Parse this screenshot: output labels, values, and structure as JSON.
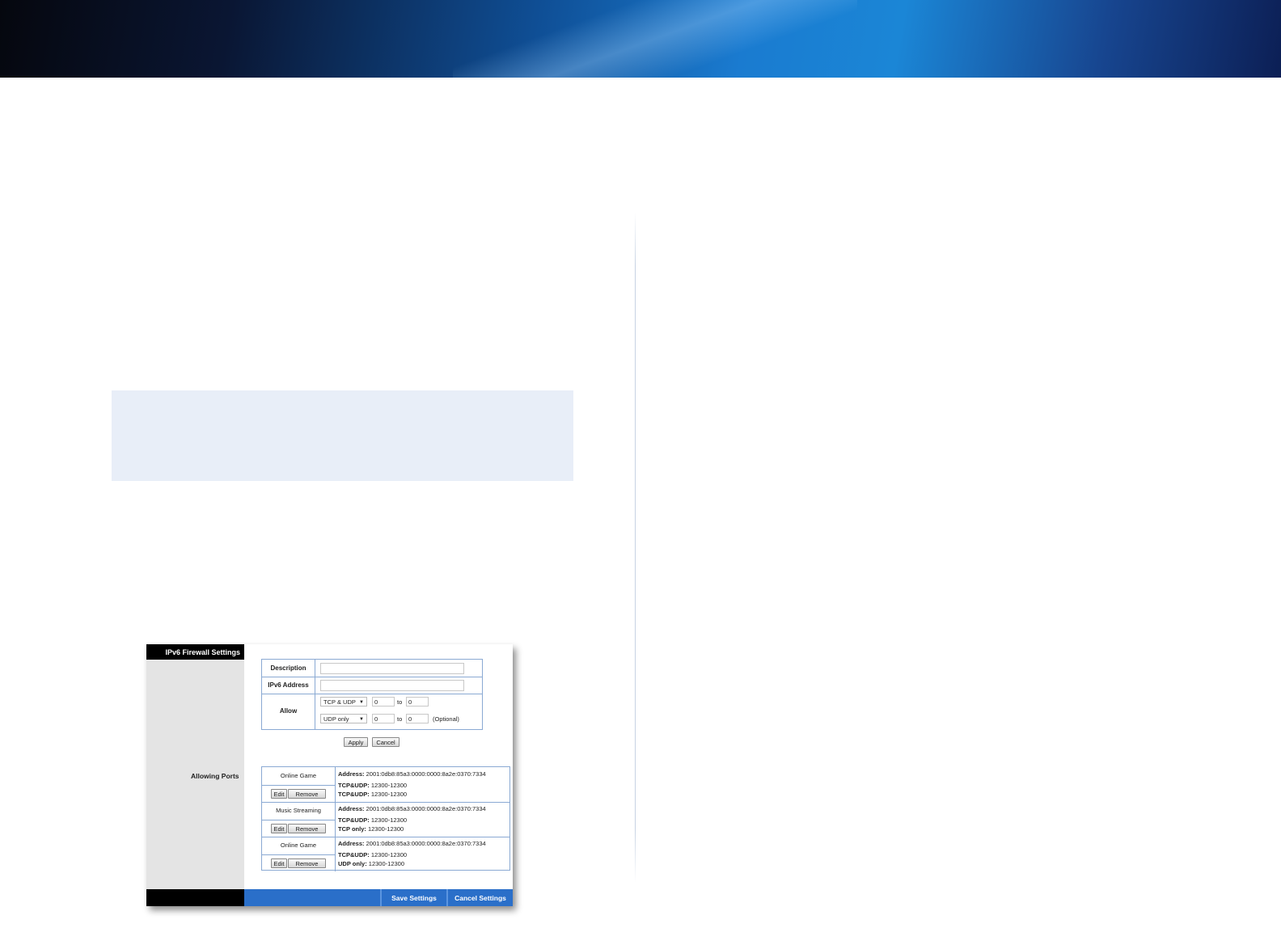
{
  "colors": {
    "banner_blue": "#1b86d6",
    "note_bg": "#e8eef8",
    "footer_blue": "#2a6fc9"
  },
  "screenshot": {
    "side_title": "IPv6 Firewall Settings",
    "side_label": "Allowing Ports",
    "form": {
      "description_label": "Description",
      "ipv6_label": "IPv6 Address",
      "allow_label": "Allow",
      "row1": {
        "protocol": "TCP & UDP",
        "from": "0",
        "to_word": "to",
        "to": "0"
      },
      "row2": {
        "protocol": "UDP only",
        "from": "0",
        "to_word": "to",
        "to": "0",
        "optional": "(Optional)"
      },
      "apply_label": "Apply",
      "cancel_label": "Cancel"
    },
    "ports": [
      {
        "name": "Online Game",
        "address_label": "Address:",
        "address": "2001:0db8:85a3:0000:0000:8a2e:0370:7334",
        "line1_label": "TCP&UDP:",
        "line1_value": "12300-12300",
        "line2_label": "TCP&UDP:",
        "line2_value": "12300-12300"
      },
      {
        "name": "Music Streaming",
        "address_label": "Address:",
        "address": "2001:0db8:85a3:0000:0000:8a2e:0370:7334",
        "line1_label": "TCP&UDP:",
        "line1_value": "12300-12300",
        "line2_label": "TCP only:",
        "line2_value": "12300-12300"
      },
      {
        "name": "Online Game",
        "address_label": "Address:",
        "address": "2001:0db8:85a3:0000:0000:8a2e:0370:7334",
        "line1_label": "TCP&UDP:",
        "line1_value": "12300-12300",
        "line2_label": "UDP only:",
        "line2_value": "12300-12300"
      }
    ],
    "edit_label": "Edit",
    "remove_label": "Remove",
    "save_settings": "Save Settings",
    "cancel_settings": "Cancel Settings"
  }
}
